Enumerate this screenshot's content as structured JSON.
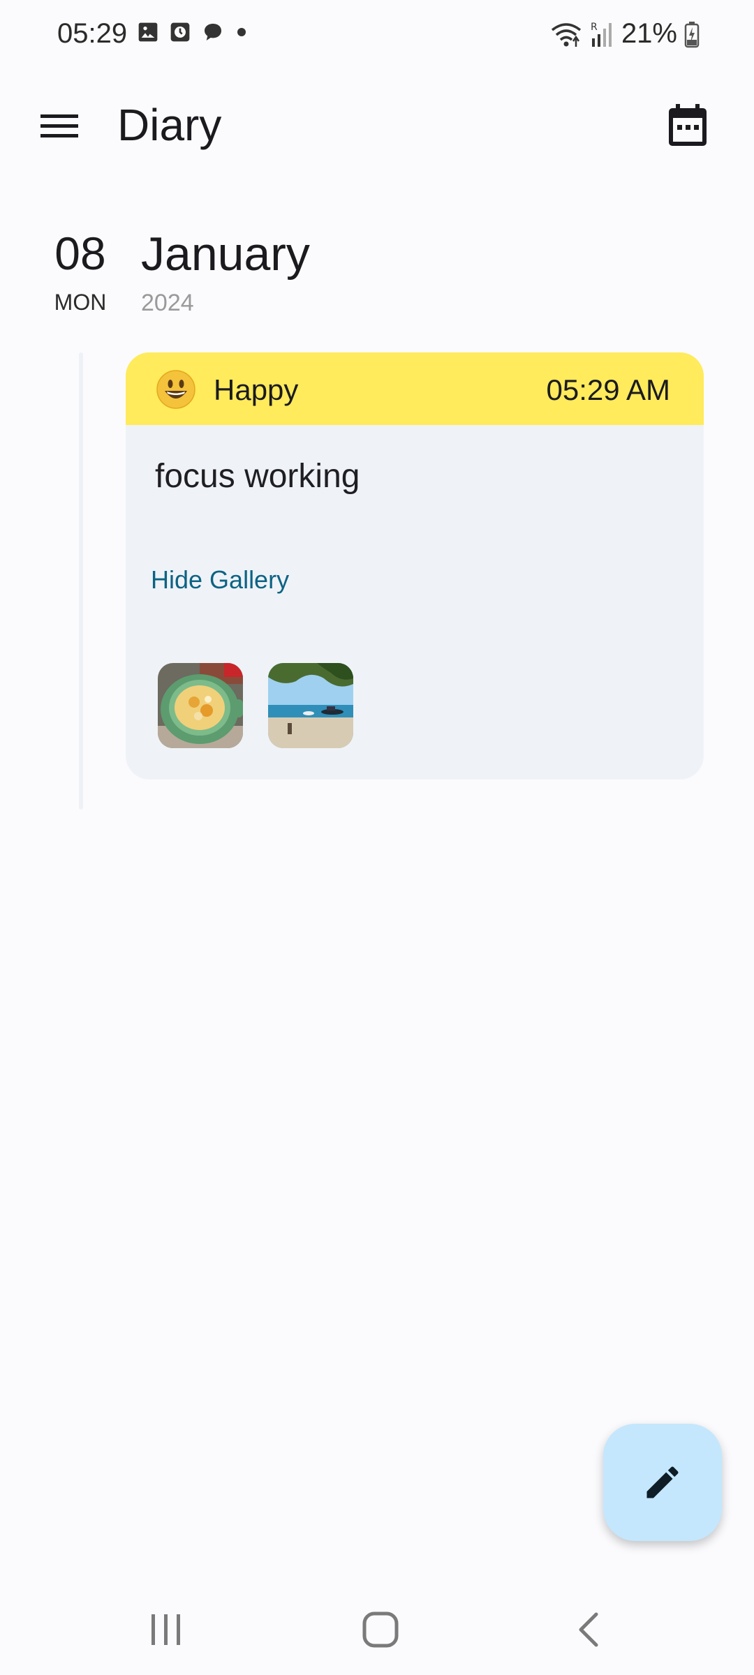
{
  "status_bar": {
    "time": "05:29",
    "battery": "21%"
  },
  "app_bar": {
    "title": "Diary"
  },
  "date_group": {
    "day": "08",
    "weekday": "MON",
    "month": "January",
    "year": "2024"
  },
  "entry": {
    "mood": "Happy",
    "time": "05:29 AM",
    "text": "focus working",
    "gallery_toggle": "Hide Gallery",
    "mood_color": "#ffeb5b"
  },
  "fab": {
    "icon": "pencil-icon",
    "color": "#c4e7fd"
  },
  "icons": {
    "menu": "hamburger-menu-icon",
    "calendar": "calendar-icon"
  }
}
